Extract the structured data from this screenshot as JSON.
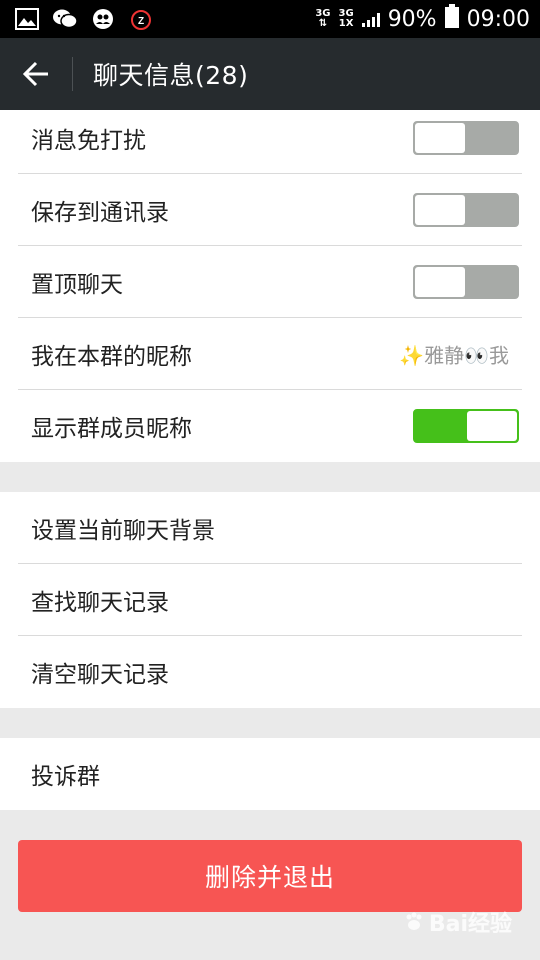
{
  "status_bar": {
    "network_1": "3G",
    "network_2_top": "3G",
    "network_2_bottom": "1X",
    "battery": "90%",
    "time": "09:00",
    "icons": [
      "gallery-icon",
      "wechat-icon",
      "contacts-icon",
      "alarm-icon"
    ]
  },
  "header": {
    "title": "聊天信息(28)",
    "back_icon": "back-arrow-icon"
  },
  "settings": {
    "group1": [
      {
        "label": "消息免打扰",
        "toggle": false
      },
      {
        "label": "保存到通讯录",
        "toggle": false
      },
      {
        "label": "置顶聊天",
        "toggle": false
      },
      {
        "label": "我在本群的昵称",
        "value": "✨雅静👀我"
      },
      {
        "label": "显示群成员昵称",
        "toggle": true
      }
    ],
    "group2": [
      {
        "label": "设置当前聊天背景"
      },
      {
        "label": "查找聊天记录"
      },
      {
        "label": "清空聊天记录"
      }
    ],
    "group3": [
      {
        "label": "投诉群"
      }
    ]
  },
  "delete_button": "删除并退出",
  "watermark": "Bai经验",
  "colors": {
    "toggle_on": "#45c01a",
    "toggle_off": "#a7aaa7",
    "danger": "#f75553",
    "header_bg": "#262b2e"
  }
}
